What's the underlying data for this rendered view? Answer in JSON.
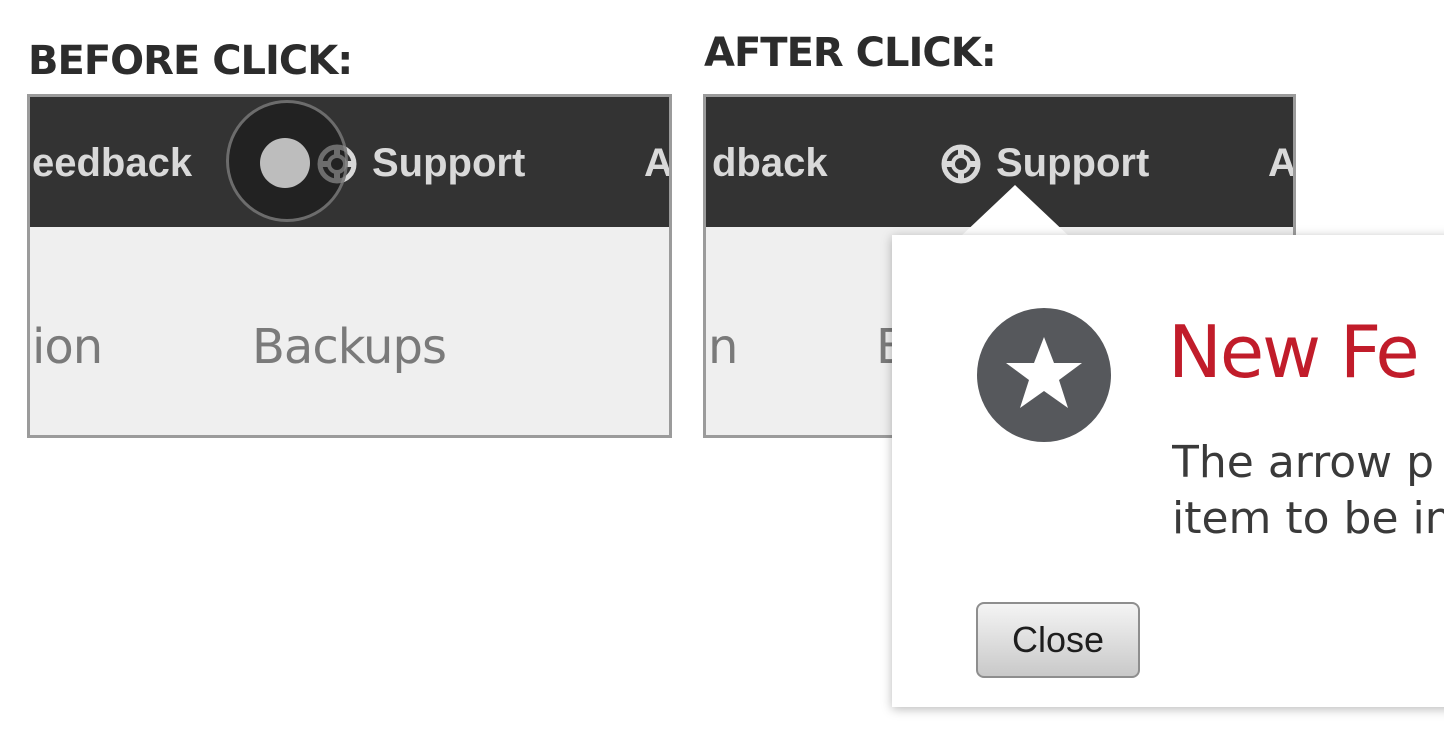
{
  "headings": {
    "before": "BEFORE CLICK:",
    "after": "AFTER CLICK:"
  },
  "before_panel": {
    "nav_left_fragment": "eedback",
    "support_label": "Support",
    "nav_right_fragment": "A",
    "sub_left_fragment": "ion",
    "sub_backups": "Backups"
  },
  "after_panel": {
    "nav_left_fragment": "dback",
    "support_label": "Support",
    "nav_right_fragment": "A",
    "sub_left_fragment": "n",
    "sub_right_fragment": "B"
  },
  "popover": {
    "icon": "star-icon",
    "title": "New Fe",
    "body_line1": "The arrow p",
    "body_line2": "item to be in",
    "close_label": "Close",
    "title_color": "#c11c2a"
  },
  "colors": {
    "topbar": "#333333",
    "subbar": "#efefef",
    "badge": "#56585c"
  }
}
